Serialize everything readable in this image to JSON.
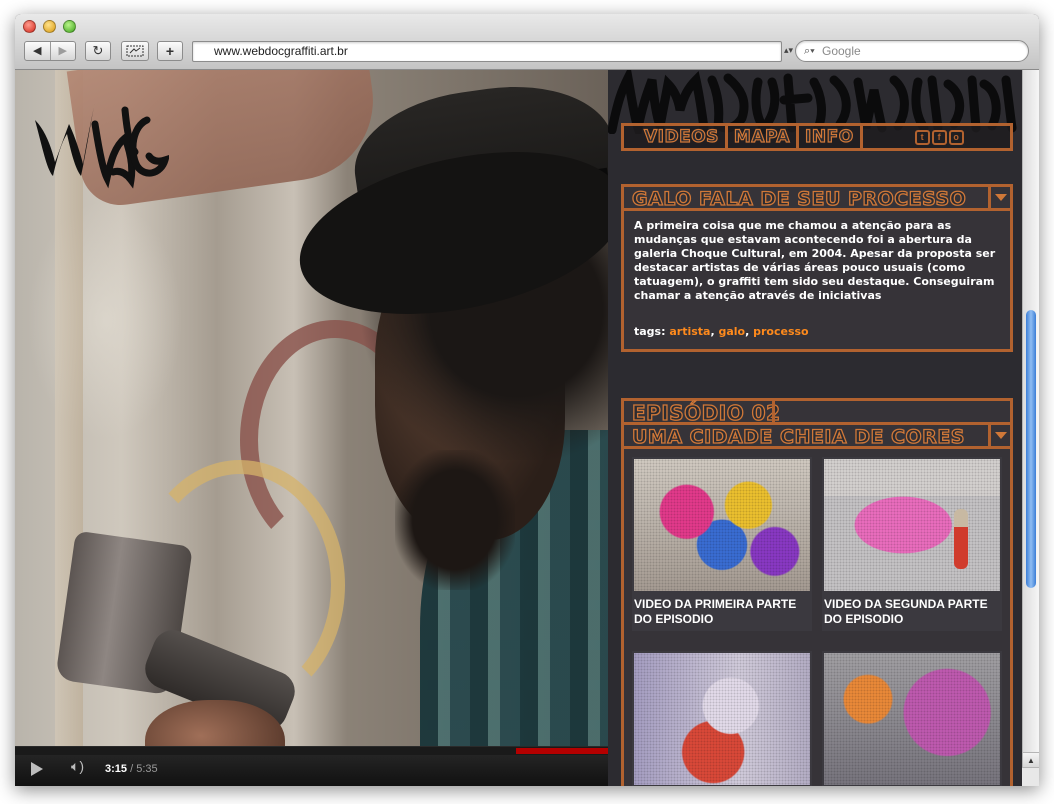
{
  "browser": {
    "url": "www.webdocgraffiti.art.br",
    "search_placeholder": "Google",
    "back_glyph": "◀",
    "forward_glyph": "▶",
    "reload_glyph": "↻",
    "add_glyph": "+"
  },
  "video": {
    "current_time": "3:15",
    "separator": " / ",
    "duration": "5:35",
    "progress_fraction": 0.58
  },
  "menu": {
    "items": [
      "VIDEOS",
      "MAPA",
      "INFO"
    ],
    "social_icons": [
      "twitter-icon",
      "facebook-icon",
      "orkut-icon"
    ],
    "social_glyphs": [
      "t",
      "f",
      "o"
    ]
  },
  "article": {
    "title": "GALO FALA DE SEU PROCESSO",
    "text": "A primeira coisa que me chamou a atenção para as mudanças que estavam acontecendo foi a abertura da galeria Choque Cultural, em 2004. Apesar da proposta ser destacar artistas de várias áreas pouco usuais (como tatuagem), o graffiti tem sido seu destaque. Conseguiram chamar a atenção através de iniciativas",
    "tags_label": "tags:",
    "tags": [
      "artista",
      "galo",
      "processo"
    ]
  },
  "episode": {
    "number_label": "EPISÓDIO 02",
    "title": "UMA CIDADE CHEIA DE CORES",
    "videos": [
      {
        "caption": "VIDEO DA PRIMEIRA PARTE DO EPISODIO"
      },
      {
        "caption": "VIDEO DA SEGUNDA PARTE DO EPISODIO"
      },
      {
        "caption": ""
      },
      {
        "caption": ""
      }
    ]
  },
  "colors": {
    "accent": "#b2622f",
    "accent_text": "#d07838",
    "tag_link": "#ff8a1c",
    "panel_bg": "#2c2b30"
  }
}
